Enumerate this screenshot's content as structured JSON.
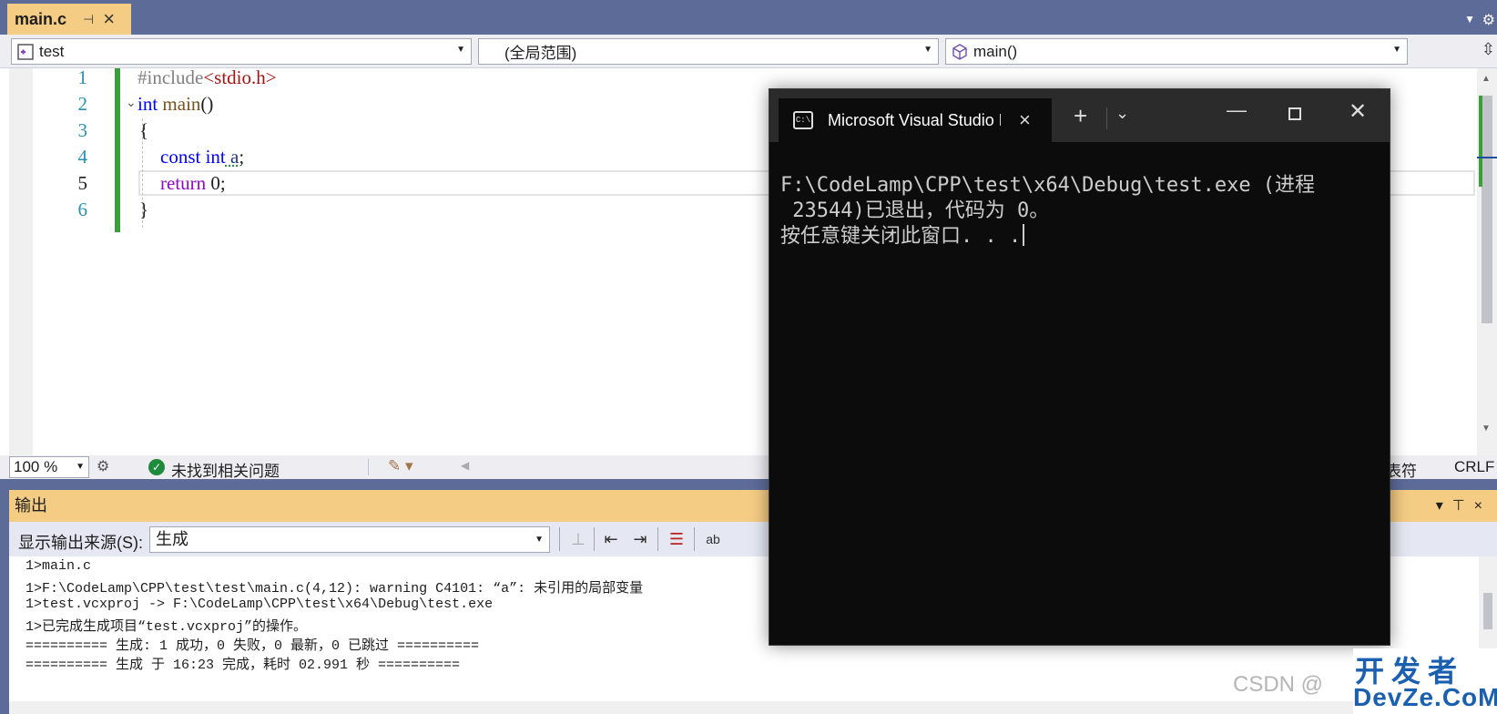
{
  "doc_tab": {
    "name": "main.c"
  },
  "navbar": {
    "project": "test",
    "scope": "(全局范围)",
    "member": "main()"
  },
  "editor": {
    "line_numbers": [
      "1",
      "2",
      "3",
      "4",
      "5",
      "6"
    ],
    "lines": {
      "l1_ppd": "#include",
      "l1_str": "<stdio.h>",
      "l2_kw": "int",
      "l2_fn": " main",
      "l2_rest": "()",
      "l3": "{",
      "l4_kw": "const int",
      "l4_var": " a",
      "l4_rest": ";",
      "l5_kw": "return",
      "l5_rest": " 0;",
      "l6": "}"
    }
  },
  "editor_status": {
    "zoom": "100 %",
    "issues": "未找到相关问题",
    "encoding_tail": "表符",
    "line_ending": "CRLF"
  },
  "output_panel": {
    "title": "输出",
    "source_label": "显示输出来源(S):",
    "source_value": "生成",
    "lines": [
      "1>main.c",
      "1>F:\\CodeLamp\\CPP\\test\\test\\main.c(4,12): warning C4101: “a”: 未引用的局部变量",
      "1>test.vcxproj -> F:\\CodeLamp\\CPP\\test\\x64\\Debug\\test.exe",
      "1>已完成生成项目“test.vcxproj”的操作。",
      "========== 生成: 1 成功，0 失败，0 最新，0 已跳过 ==========",
      "========== 生成 于 16:23 完成，耗时 02.991 秒 =========="
    ]
  },
  "console": {
    "title": "Microsoft Visual Studio Debug Console",
    "line1": "F:\\CodeLamp\\CPP\\test\\x64\\Debug\\test.exe (进程",
    "line2": " 23544)已退出，代码为 0。",
    "line3": "按任意键关闭此窗口. . ."
  },
  "watermark": {
    "csdn": "CSDN @",
    "logo_top": "开发者",
    "logo_bottom": "DevZe.CoM"
  },
  "colors": {
    "tab_active": "#f5cc84",
    "vs_frame": "#5d6b99",
    "console_bg": "#0c0c0c"
  }
}
